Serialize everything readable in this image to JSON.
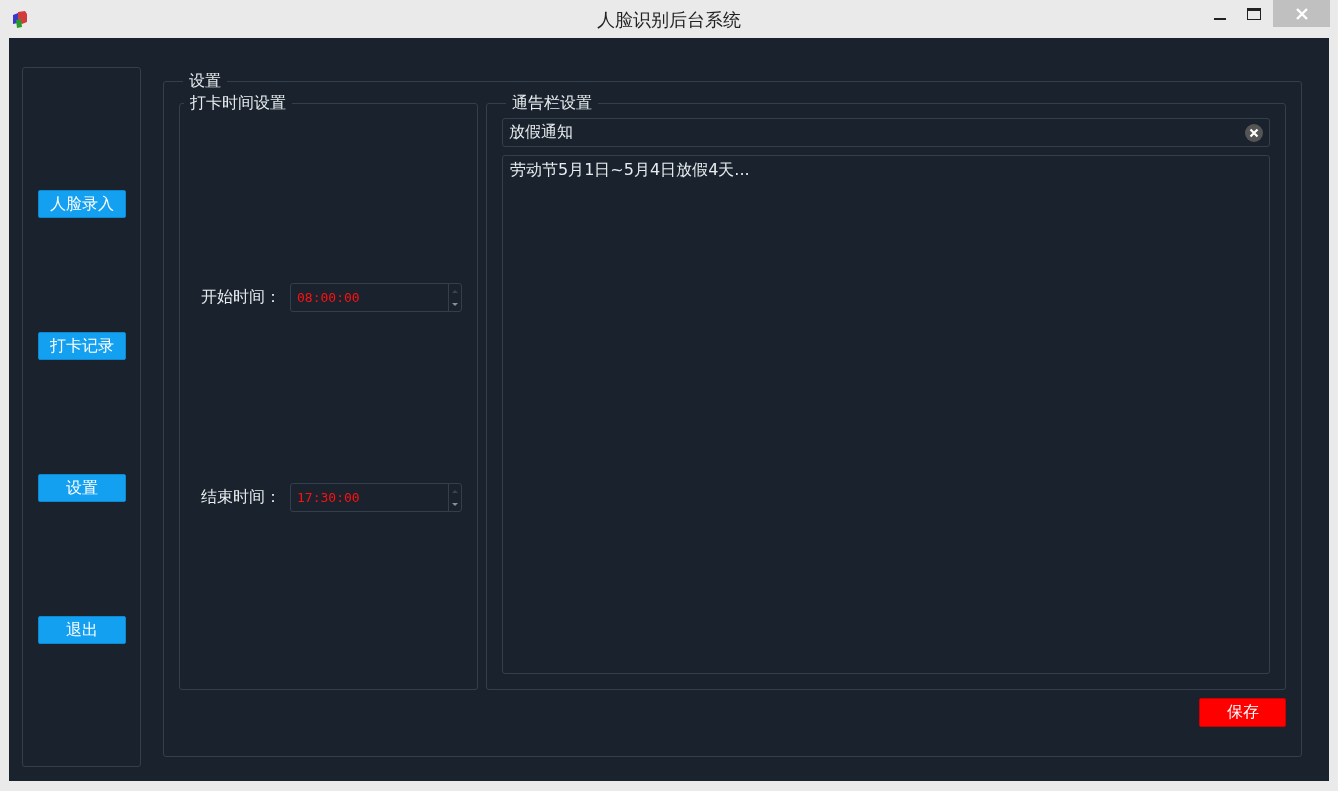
{
  "window": {
    "title": "人脸识别后台系统"
  },
  "sidebar": {
    "buttons": [
      {
        "label": "人脸录入"
      },
      {
        "label": "打卡记录"
      },
      {
        "label": "设置"
      },
      {
        "label": "退出"
      }
    ]
  },
  "settings": {
    "title": "设置",
    "punch_time": {
      "title": "打卡时间设置",
      "fields": [
        {
          "label": "开始时间：",
          "value": "08:00:00"
        },
        {
          "label": "结束时间：",
          "value": "17:30:00"
        }
      ]
    },
    "notice": {
      "title": "通告栏设置",
      "subject": "放假通知",
      "body": "劳动节5月1日~5月4日放假4天..."
    },
    "save_button": "保存"
  }
}
